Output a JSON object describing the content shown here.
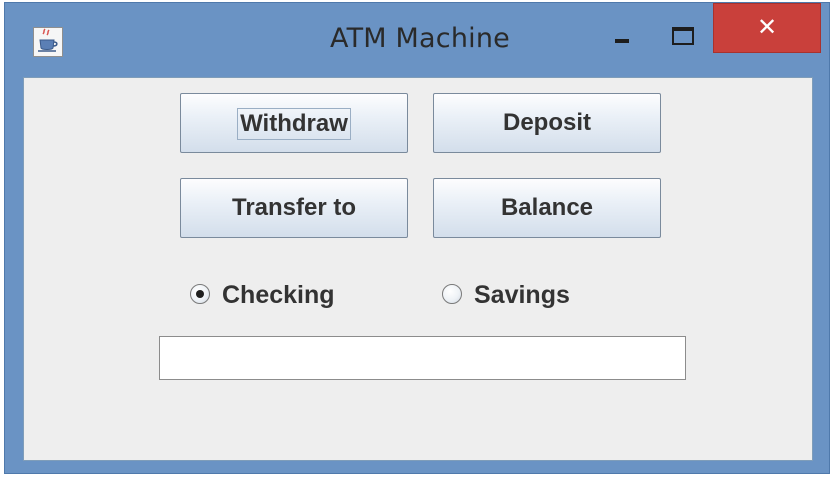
{
  "window": {
    "title": "ATM Machine",
    "icon": "java-cup-icon",
    "controls": {
      "minimize": "minimize-icon",
      "maximize": "maximize-icon",
      "close_label": "✕"
    },
    "colors": {
      "frame": "#6a93c4",
      "close": "#c9403b",
      "client": "#eeeeee"
    }
  },
  "buttons": {
    "withdraw": "Withdraw",
    "deposit": "Deposit",
    "transfer": "Transfer to",
    "balance": "Balance"
  },
  "account": {
    "checking_label": "Checking",
    "savings_label": "Savings",
    "selected": "Checking"
  },
  "amount": {
    "value": "",
    "placeholder": ""
  }
}
